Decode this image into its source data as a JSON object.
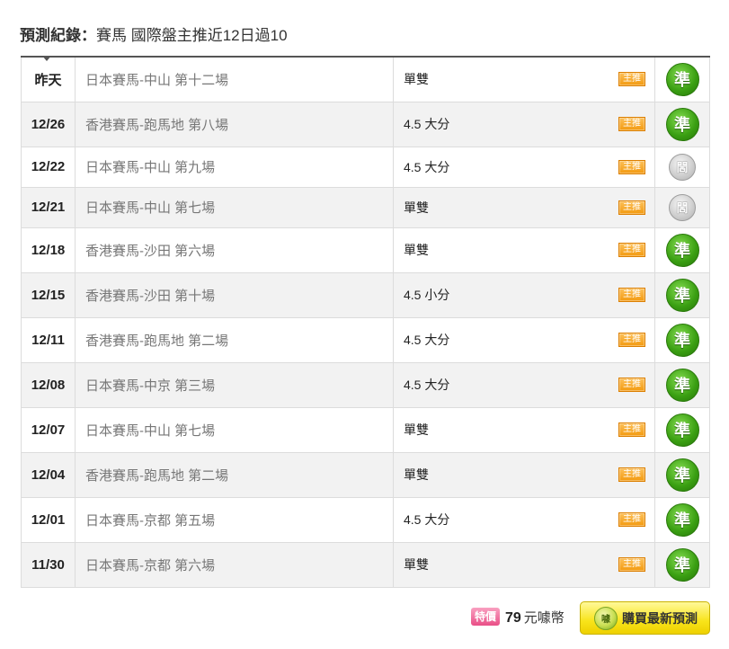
{
  "header": {
    "label": "預測紀錄：",
    "summary": "賽馬 國際盤主推近12日過10"
  },
  "records": [
    {
      "date": "昨天",
      "event": "日本賽馬-中山 第十二場",
      "pick": "單雙",
      "tag": "主推",
      "result": "準",
      "result_icon": "hit-badge-icon"
    },
    {
      "date": "12/26",
      "event": "香港賽馬-跑馬地 第八場",
      "pick": "4.5 大分",
      "tag": "主推",
      "result": "準",
      "result_icon": "hit-badge-icon"
    },
    {
      "date": "12/22",
      "event": "日本賽馬-中山 第九場",
      "pick": "4.5 大分",
      "tag": "主推",
      "result": "閪",
      "result_icon": "miss-badge-icon"
    },
    {
      "date": "12/21",
      "event": "日本賽馬-中山 第七場",
      "pick": "單雙",
      "tag": "主推",
      "result": "閪",
      "result_icon": "miss-badge-icon"
    },
    {
      "date": "12/18",
      "event": "香港賽馬-沙田 第六場",
      "pick": "單雙",
      "tag": "主推",
      "result": "準",
      "result_icon": "hit-badge-icon"
    },
    {
      "date": "12/15",
      "event": "香港賽馬-沙田 第十場",
      "pick": "4.5 小分",
      "tag": "主推",
      "result": "準",
      "result_icon": "hit-badge-icon"
    },
    {
      "date": "12/11",
      "event": "香港賽馬-跑馬地 第二場",
      "pick": "4.5 大分",
      "tag": "主推",
      "result": "準",
      "result_icon": "hit-badge-icon"
    },
    {
      "date": "12/08",
      "event": "日本賽馬-中京 第三場",
      "pick": "4.5 大分",
      "tag": "主推",
      "result": "準",
      "result_icon": "hit-badge-icon"
    },
    {
      "date": "12/07",
      "event": "日本賽馬-中山 第七場",
      "pick": "單雙",
      "tag": "主推",
      "result": "準",
      "result_icon": "hit-badge-icon"
    },
    {
      "date": "12/04",
      "event": "香港賽馬-跑馬地 第二場",
      "pick": "單雙",
      "tag": "主推",
      "result": "準",
      "result_icon": "hit-badge-icon"
    },
    {
      "date": "12/01",
      "event": "日本賽馬-京都 第五場",
      "pick": "4.5 大分",
      "tag": "主推",
      "result": "準",
      "result_icon": "hit-badge-icon"
    },
    {
      "date": "11/30",
      "event": "日本賽馬-京都 第六場",
      "pick": "單雙",
      "tag": "主推",
      "result": "準",
      "result_icon": "hit-badge-icon"
    }
  ],
  "footer": {
    "sale_badge": "特價",
    "price": "79",
    "price_unit": "元噱幣",
    "buy_button": "購買最新預測",
    "coin_icon": "coin-icon",
    "coin_glyph": "噱"
  },
  "colors": {
    "hit": "#3a9f12",
    "miss": "#b0b0b0",
    "tag": "#f39a10",
    "sale": "#e94f87",
    "button": "#f8e41a",
    "border_top": "#555555"
  }
}
